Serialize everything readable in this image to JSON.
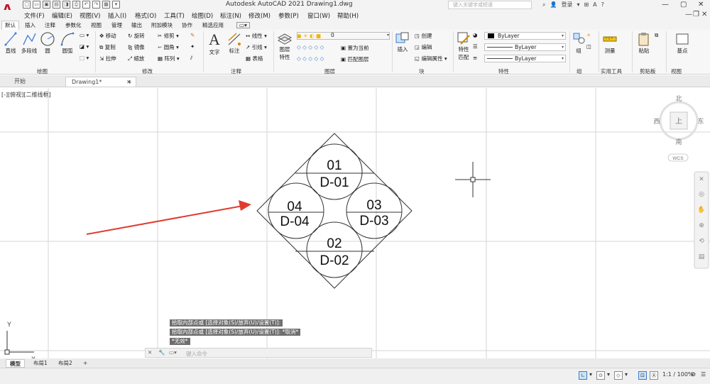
{
  "titlebar": {
    "title": "Autodesk AutoCAD 2021    Drawing1.dwg",
    "search_placeholder": "键入关键字或短语",
    "login": "登录"
  },
  "menu": [
    "文件(F)",
    "编辑(E)",
    "视图(V)",
    "插入(I)",
    "格式(O)",
    "工具(T)",
    "绘图(D)",
    "标注(N)",
    "修改(M)",
    "参数(P)",
    "窗口(W)",
    "帮助(H)"
  ],
  "ribbon_tabs": [
    "默认",
    "插入",
    "注释",
    "参数化",
    "视图",
    "管理",
    "输出",
    "附加模块",
    "协作",
    "精选应用"
  ],
  "ribbon": {
    "draw": {
      "line": "直线",
      "polyline": "多段线",
      "circle": "圆",
      "arc": "圆弧",
      "label": "绘图"
    },
    "modify": {
      "move": "移动",
      "rotate": "旋转",
      "trim": "修剪",
      "copy": "复制",
      "mirror": "镜像",
      "fillet": "圆角",
      "stretch": "拉伸",
      "scale": "缩放",
      "array": "阵列",
      "label": "修改"
    },
    "annotation": {
      "text": "文字",
      "dimension": "标注",
      "linear": "线性",
      "leader": "引线",
      "table": "表格",
      "label": "注释"
    },
    "layers": {
      "layer_props": "图层",
      "layer_props2": "特性",
      "current_layer": "0",
      "set_current": "置为当前",
      "match_layer": "匹配图层",
      "label": "图层"
    },
    "block": {
      "insert": "插入",
      "create": "创建",
      "edit": "编辑",
      "edit_attr": "编辑属性",
      "label": "块"
    },
    "properties": {
      "match": "特性",
      "match2": "匹配",
      "color": "ByLayer",
      "linetype": "ByLayer",
      "lineweight": "ByLayer",
      "label": "特性"
    },
    "groups": {
      "group": "组",
      "label": "组"
    },
    "utilities": {
      "measure": "测量",
      "label": "实用工具"
    },
    "clipboard": {
      "paste": "粘贴",
      "label": "剪贴板"
    },
    "view": {
      "base": "基点",
      "label": "视图"
    }
  },
  "file_tabs": {
    "start": "开始",
    "drawing": "Drawing1*"
  },
  "viewport": {
    "label": "[-][俯视][二维线框]"
  },
  "viewcube": {
    "north": "北",
    "south": "南",
    "east": "东",
    "west": "西",
    "top": "上",
    "wcs": "WCS"
  },
  "drawing": {
    "circles": [
      {
        "num": "01",
        "code": "D-01"
      },
      {
        "num": "02",
        "code": "D-02"
      },
      {
        "num": "03",
        "code": "D-03"
      },
      {
        "num": "04",
        "code": "D-04"
      }
    ]
  },
  "ucs": {
    "x": "X",
    "y": "Y"
  },
  "command": {
    "history": [
      "拾取内部点或 [选择对象(S)/放弃(U)/设置(T)]:",
      "拾取内部点或 [选择对象(S)/放弃(U)/设置(T)]: *取消*",
      "*无效*"
    ],
    "placeholder": "键入命令"
  },
  "layout_tabs": [
    "模型",
    "布局1",
    "布局2",
    "+"
  ],
  "status": {
    "scale": "1:1 / 100%"
  }
}
